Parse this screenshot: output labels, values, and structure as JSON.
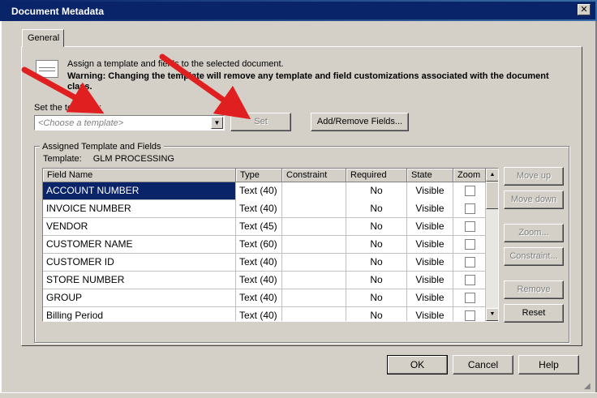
{
  "window": {
    "title": "Document Metadata",
    "close_glyph": "✕"
  },
  "tabs": [
    {
      "label": "General"
    }
  ],
  "info": {
    "text": "Assign a template and fields to the selected document.",
    "warning": "Warning: Changing the template will remove any template and field customizations associated with the document class."
  },
  "template_picker": {
    "label": "Set the template:",
    "placeholder": "<Choose a template>",
    "set_label": "Set",
    "add_remove_label": "Add/Remove Fields..."
  },
  "assigned": {
    "group_title": "Assigned Template and Fields",
    "template_label": "Template:",
    "template_value": "GLM PROCESSING"
  },
  "grid": {
    "columns": [
      "Field Name",
      "Type",
      "Constraint",
      "Required",
      "State",
      "Zoom"
    ],
    "rows": [
      {
        "name": "ACCOUNT NUMBER",
        "type": "Text (40)",
        "constraint": "",
        "required": "No",
        "state": "Visible",
        "zoom": false,
        "selected": true
      },
      {
        "name": "INVOICE NUMBER",
        "type": "Text (40)",
        "constraint": "",
        "required": "No",
        "state": "Visible",
        "zoom": false,
        "selected": false
      },
      {
        "name": "VENDOR",
        "type": "Text (45)",
        "constraint": "",
        "required": "No",
        "state": "Visible",
        "zoom": false,
        "selected": false
      },
      {
        "name": "CUSTOMER NAME",
        "type": "Text (60)",
        "constraint": "",
        "required": "No",
        "state": "Visible",
        "zoom": false,
        "selected": false
      },
      {
        "name": "CUSTOMER ID",
        "type": "Text (40)",
        "constraint": "",
        "required": "No",
        "state": "Visible",
        "zoom": false,
        "selected": false
      },
      {
        "name": "STORE NUMBER",
        "type": "Text (40)",
        "constraint": "",
        "required": "No",
        "state": "Visible",
        "zoom": false,
        "selected": false
      },
      {
        "name": "GROUP",
        "type": "Text (40)",
        "constraint": "",
        "required": "No",
        "state": "Visible",
        "zoom": false,
        "selected": false
      },
      {
        "name": "Billing Period",
        "type": "Text (40)",
        "constraint": "",
        "required": "No",
        "state": "Visible",
        "zoom": false,
        "selected": false
      }
    ]
  },
  "side_buttons": {
    "move_up": "Move up",
    "move_down": "Move down",
    "zoom": "Zoom...",
    "constraint": "Constraint...",
    "remove": "Remove",
    "reset": "Reset"
  },
  "footer": {
    "ok": "OK",
    "cancel": "Cancel",
    "help": "Help"
  },
  "colors": {
    "title_bar": "#0a246a",
    "selection": "#0a246a",
    "annotation_arrow": "#e02020",
    "dialog_face": "#d4d0c8"
  },
  "icons": {
    "document": "document-icon",
    "dropdown": "chevron-down-icon",
    "scroll_up": "scroll-up-icon",
    "scroll_down": "scroll-down-icon",
    "resize": "resize-grip-icon"
  }
}
